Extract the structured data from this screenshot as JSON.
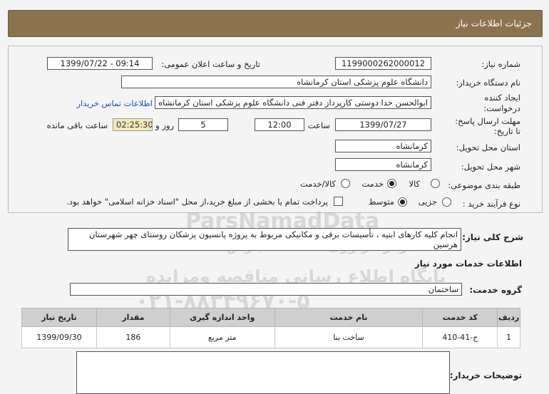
{
  "header": {
    "title": "جزئیات اطلاعات نیاز"
  },
  "form": {
    "need_number_label": "شماره نیاز:",
    "need_number": "1199000262000012",
    "announce_label": "تاریخ و ساعت اعلان عمومی:",
    "announce_value": "1399/07/22 - 09:14",
    "buyer_org_label": "نام دستگاه خریدار:",
    "buyer_org": "دانشگاه علوم پزشکی  استان کرمانشاه",
    "creator_label_1": "ایجاد کننده",
    "creator_label_2": "درخواست:",
    "creator": "ابوالحسن خدا دوستی کارپرداز دفتر فنی دانشگاه علوم پزشکی  استان کرمانشاه",
    "contact_link": "اطلاعات تماس خریدار",
    "deadline_label_1": "مهلت ارسال پاسخ:",
    "deadline_label_2": "تا تاریخ:",
    "deadline_date": "1399/07/27",
    "time_label": "ساعت",
    "deadline_time": "12:00",
    "days_value": "5",
    "days_label": "روز و",
    "remaining_time": "02:25:30",
    "remaining_label": "ساعت باقی مانده",
    "province_label": "استان محل تحویل:",
    "province": "کرمانشاه",
    "city_label": "شهر محل تحویل:",
    "city": "کرمانشاه",
    "category_label": "طبقه بندی موضوعی:",
    "category_options": [
      "کالا",
      "خدمت",
      "کالا/خدمت"
    ],
    "category_selected": "خدمت",
    "process_label": "نوع فرآیند خرید :",
    "process_options": [
      "جزیی",
      "متوسط"
    ],
    "process_selected": "متوسط",
    "payment_note": "پرداخت تمام یا بخشی از مبلغ خرید،از محل \"اسناد خزانه اسلامی\" خواهد بود."
  },
  "summary": {
    "label": "شرح کلی نیاز:",
    "text": "انجام کلیه کارهای ابنیه ، تأسیسات برقی و مکانیکی مربوط به پروژه پانسیون پزشکان روستای چهر شهرستان هرسین"
  },
  "services": {
    "section_title": "اطلاعات خدمات مورد نیاز",
    "group_label": "گروه خدمت:",
    "group_value": "ساختمان",
    "columns": [
      "ردیف",
      "کد خدمت",
      "نام خدمت",
      "واحد اندازه گیری",
      "مقدار",
      "تاریخ نیاز"
    ],
    "rows": [
      [
        "1",
        "ج-41-410",
        "ساخت بنا",
        "متر مربع",
        "186",
        "1399/09/30"
      ]
    ]
  },
  "notes": {
    "label": "توضیحات خریدار:"
  },
  "watermark": {
    "line1": "ParsNamadData",
    "line2": "مرکز فراوری اطلاعات پارس نماد داده",
    "line3": "پایگاه اطلاع رسانی مناقصه ومزایده",
    "line4": "۰۲۱-۸۸۳۴۹۶۷۰-۵"
  },
  "colors": {
    "header_bg": "#8b7350",
    "link": "#1a55b5",
    "remaining_bg": "#f3e8b8"
  }
}
